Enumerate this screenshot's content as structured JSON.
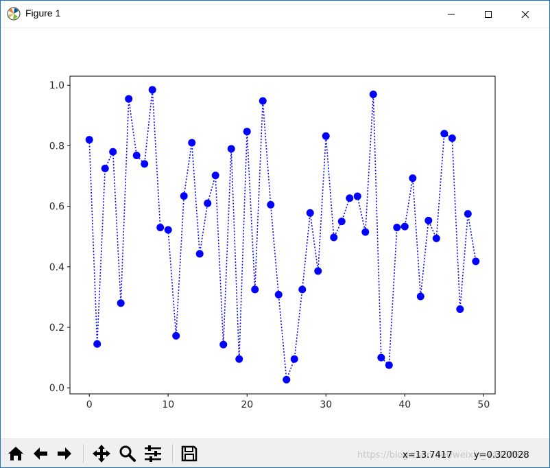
{
  "window": {
    "title": "Figure 1"
  },
  "toolbar": {
    "buttons": [
      "home-icon",
      "back-arrow-icon",
      "forward-arrow-icon",
      "pan-icon",
      "zoom-icon",
      "configure-subplots-icon",
      "save-icon"
    ],
    "x_readout": "x=13.7417",
    "y_readout": "y=0.320028",
    "watermark": "https://blog.csdn.net/weixin_4435099"
  },
  "chart_data": {
    "type": "line",
    "marker": "circle",
    "linestyle": "dotted",
    "color": "#0000ff",
    "x": [
      0,
      1,
      2,
      3,
      4,
      5,
      6,
      7,
      8,
      9,
      10,
      11,
      12,
      13,
      14,
      15,
      16,
      17,
      18,
      19,
      20,
      21,
      22,
      23,
      24,
      25,
      26,
      27,
      28,
      29,
      30,
      31,
      32,
      33,
      34,
      35,
      36,
      37,
      38,
      39,
      40,
      41,
      42,
      43,
      44,
      45,
      46,
      47,
      48,
      49
    ],
    "y": [
      0.82,
      0.145,
      0.725,
      0.78,
      0.28,
      0.955,
      0.768,
      0.74,
      0.985,
      0.53,
      0.522,
      0.172,
      0.634,
      0.81,
      0.443,
      0.61,
      0.702,
      0.143,
      0.79,
      0.095,
      0.847,
      0.325,
      0.948,
      0.605,
      0.308,
      0.027,
      0.095,
      0.325,
      0.578,
      0.386,
      0.832,
      0.497,
      0.55,
      0.627,
      0.633,
      0.515,
      0.97,
      0.1,
      0.075,
      0.53,
      0.533,
      0.693,
      0.302,
      0.553,
      0.494,
      0.84,
      0.825,
      0.26,
      0.575,
      0.418
    ],
    "xlim": [
      -2.45,
      51.45
    ],
    "ylim": [
      -0.02,
      1.03
    ],
    "xticks": [
      0,
      10,
      20,
      30,
      40,
      50
    ],
    "yticks": [
      0.0,
      0.2,
      0.4,
      0.6,
      0.8,
      1.0
    ],
    "xticklabels": [
      "0",
      "10",
      "20",
      "30",
      "40",
      "50"
    ],
    "yticklabels": [
      "0.0",
      "0.2",
      "0.4",
      "0.6",
      "0.8",
      "1.0"
    ],
    "grid": false
  }
}
